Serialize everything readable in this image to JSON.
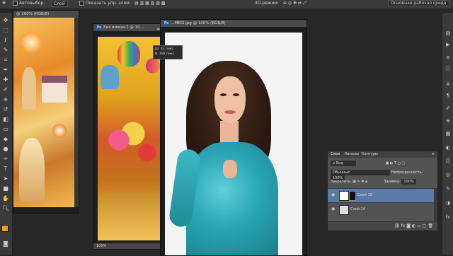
{
  "options_bar": {
    "auto_select_label": "Автовыбор:",
    "auto_select_value": "Слой",
    "show_transform_label": "Показать упр. элем.",
    "mode_3d_label": "3D-режим:",
    "workspace": "Основная рабочая среда"
  },
  "windows": {
    "left_title": "@ 100% (RGB/8)",
    "middle_title": "Без имени-1 @ 10...",
    "middle_zoom": "100%",
    "main_title": "...MEGI.jpg @ 100% (RGB/8)",
    "info_w": "Ш: 33 пикс.",
    "info_h": "В: 192 пикс."
  },
  "layers_panel": {
    "tabs": [
      "Слои",
      "Каналы",
      "Контуры"
    ],
    "kind_label": "Вид",
    "blend_mode": "Обычные",
    "opacity_label": "Непрозрачность:",
    "opacity_value": "100%",
    "lock_label": "Закрепить:",
    "fill_label": "Заливка:",
    "fill_value": "100%",
    "layers": [
      {
        "name": "Слой 15",
        "selected": true
      },
      {
        "name": "Слой 14",
        "selected": false
      }
    ],
    "footer_icons": [
      "link-icon",
      "fx-icon",
      "mask-icon",
      "adjustment-icon",
      "folder-icon",
      "new-layer-icon",
      "trash-icon"
    ]
  },
  "colors": {
    "background": "#272727",
    "panel": "#535353",
    "selected_layer": "#5a7aa8",
    "foreground_swatch": "#f0a020",
    "dress": "#2aa6b4"
  }
}
